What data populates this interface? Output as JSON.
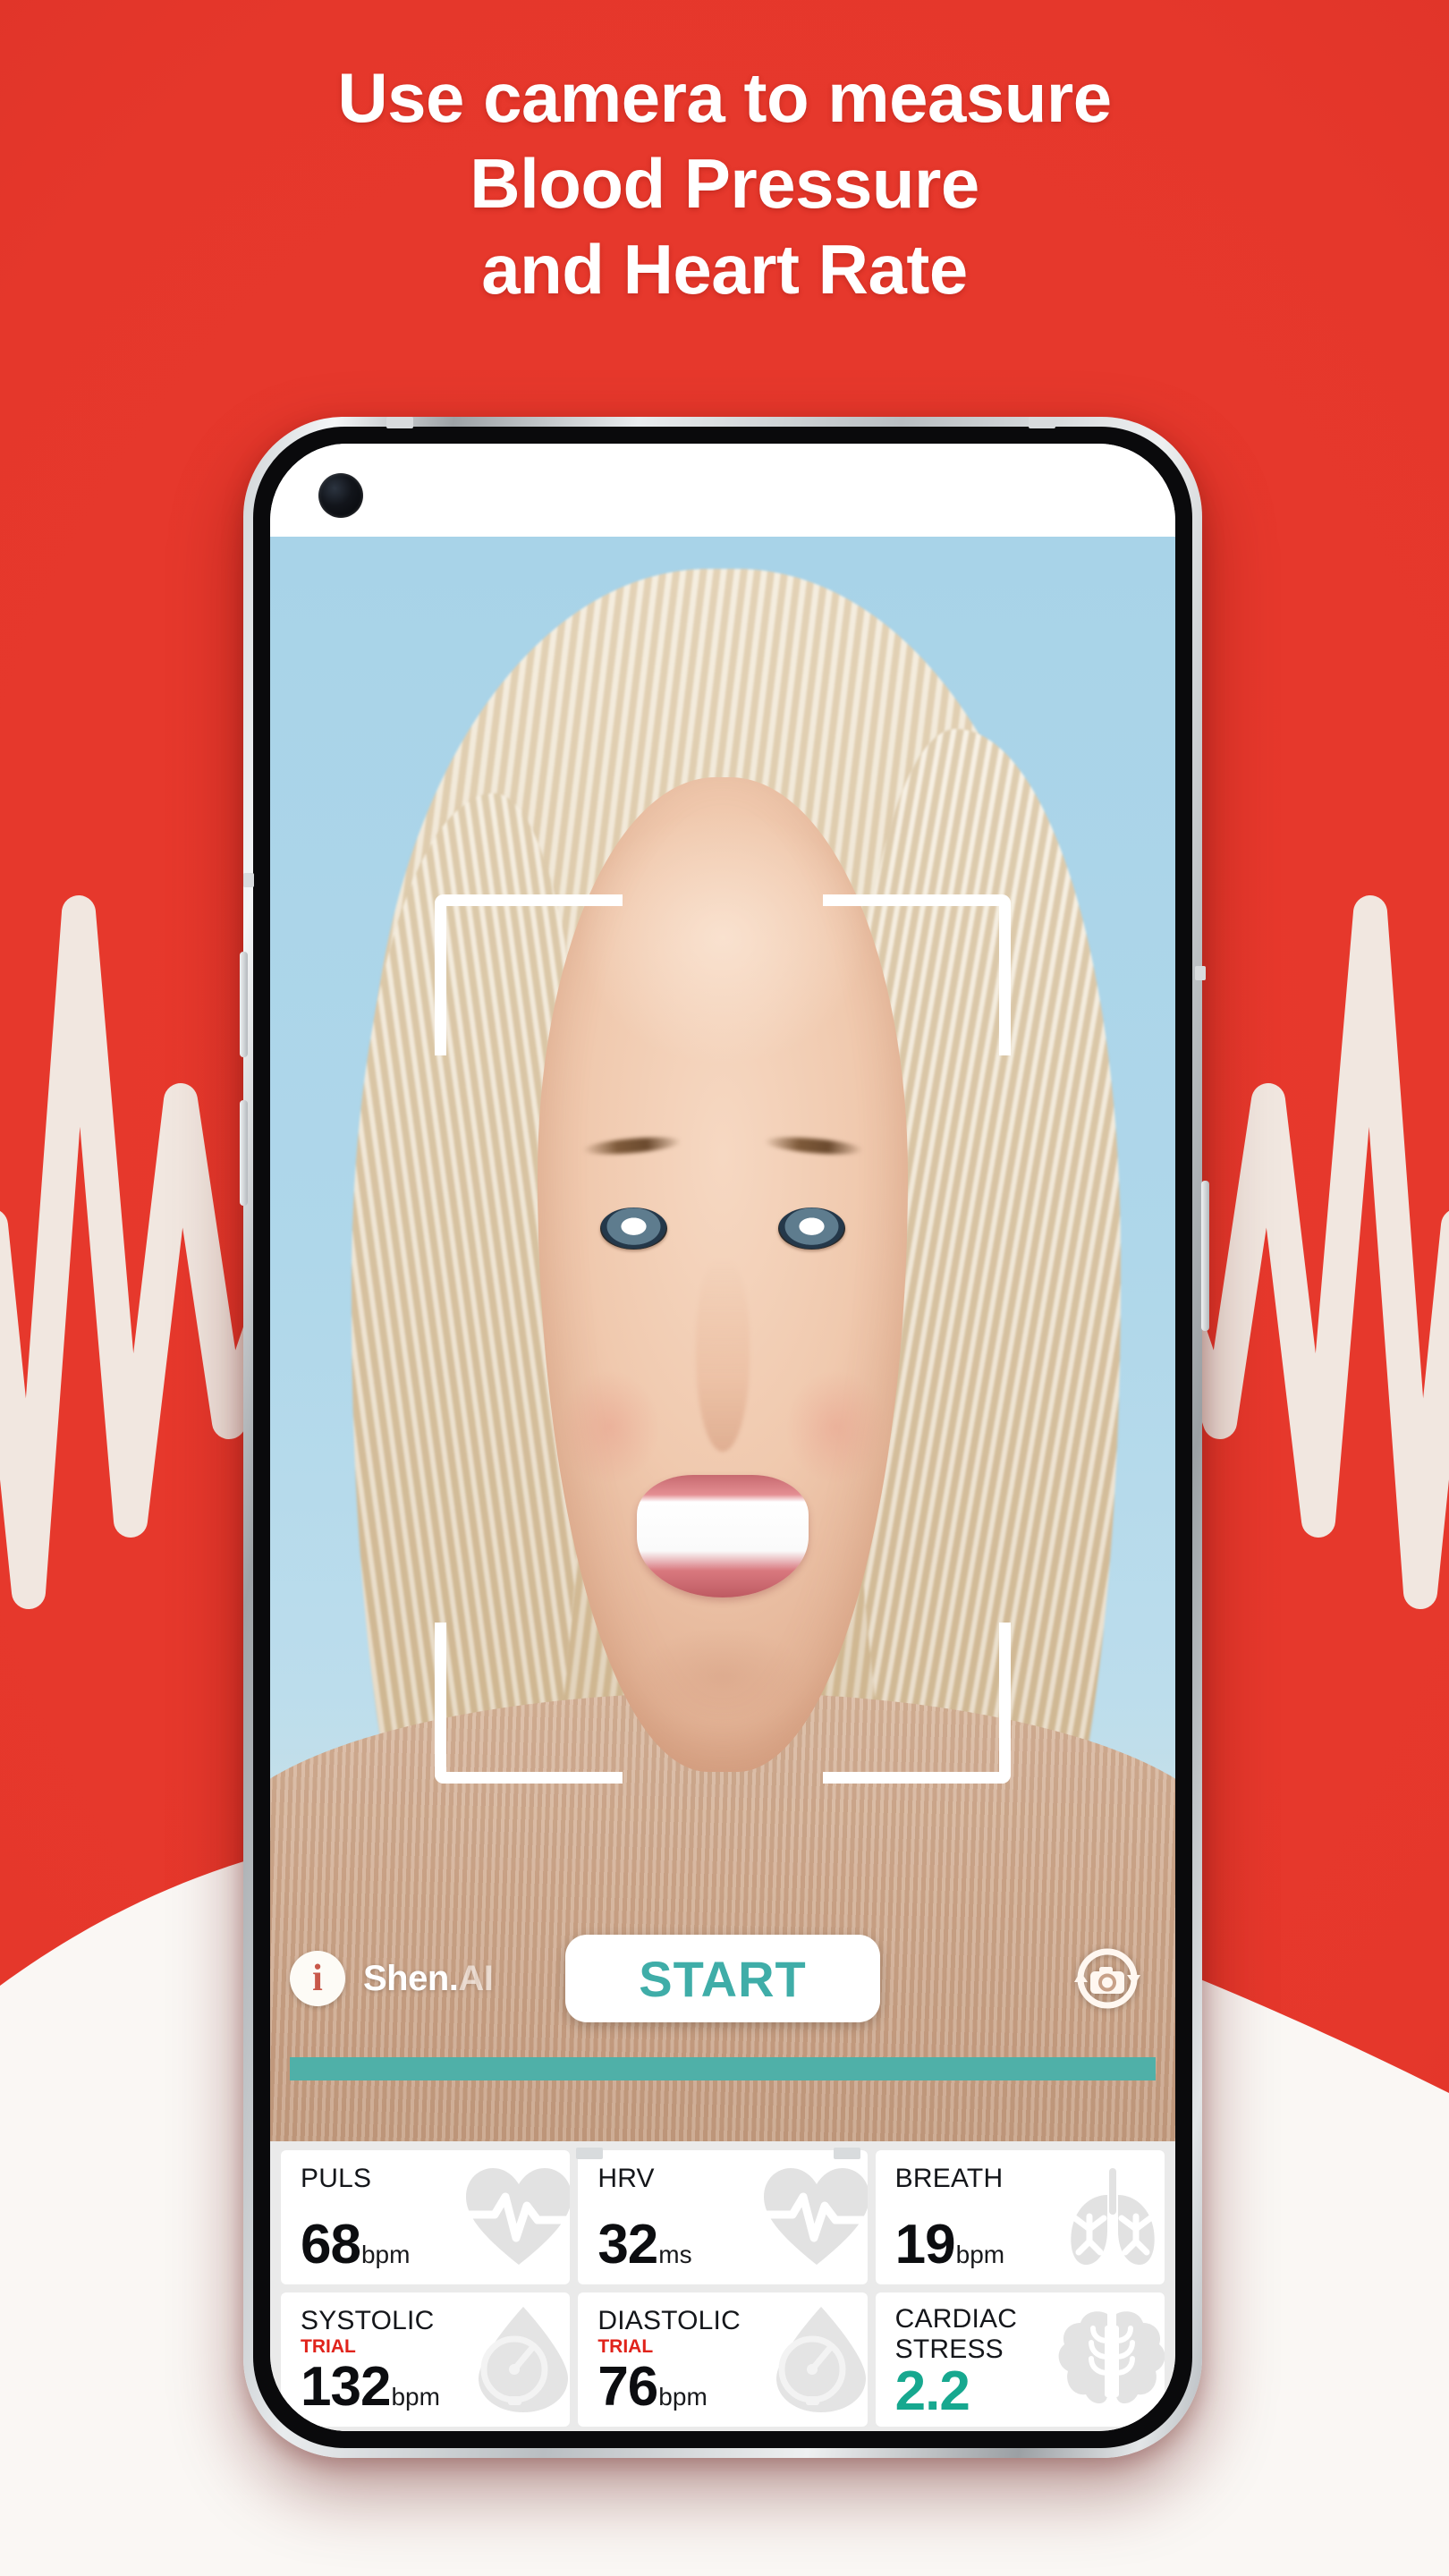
{
  "theme": {
    "background_red": "#E5372B",
    "accent_teal": "#3FADA8",
    "progress_teal": "#4FB0A8",
    "stress_teal": "#17A88F",
    "trial_red": "#E0231B",
    "panel_gray": "#EAEAEA",
    "card_white": "#FFFFFF",
    "headline_white": "#FFFFFF"
  },
  "headline": {
    "line1": "Use camera to measure",
    "line2": "Blood Pressure",
    "line3": "and Heart Rate"
  },
  "phone": {
    "status_bar": {
      "camera_icon": "punch-hole-camera"
    }
  },
  "camera_view": {
    "face_brackets": "face-tracking-brackets",
    "subject_alt": "smiling woman face in camera preview"
  },
  "controls": {
    "info_glyph": "i",
    "info_label": "info-button",
    "brand_main": "Shen.",
    "brand_suffix": "AI",
    "start_label": "START",
    "flip_camera_label": "switch-camera"
  },
  "progress": {
    "percent": 100
  },
  "metrics": {
    "rows": [
      [
        {
          "label": "PULS",
          "trial": "",
          "value": "68",
          "unit": "bpm",
          "icon": "heart-pulse-icon",
          "teal": false,
          "two_line": false
        },
        {
          "label": "HRV",
          "trial": "",
          "value": "32",
          "unit": "ms",
          "icon": "heart-pulse-icon",
          "teal": false,
          "two_line": false
        },
        {
          "label": "BREATH",
          "trial": "",
          "value": "19",
          "unit": "bpm",
          "icon": "lungs-icon",
          "teal": false,
          "two_line": false
        }
      ],
      [
        {
          "label": "SYSTOLIC",
          "trial": "TRIAL",
          "value": "132",
          "unit": "bpm",
          "icon": "blood-drop-gauge-icon",
          "teal": false,
          "two_line": false
        },
        {
          "label": "DIASTOLIC",
          "trial": "TRIAL",
          "value": "76",
          "unit": "bpm",
          "icon": "blood-drop-gauge-icon",
          "teal": false,
          "two_line": false
        },
        {
          "label": "CARDIAC\nSTRESS",
          "trial": "",
          "value": "2.2",
          "unit": "",
          "icon": "brain-icon",
          "teal": true,
          "two_line": true
        }
      ]
    ]
  }
}
